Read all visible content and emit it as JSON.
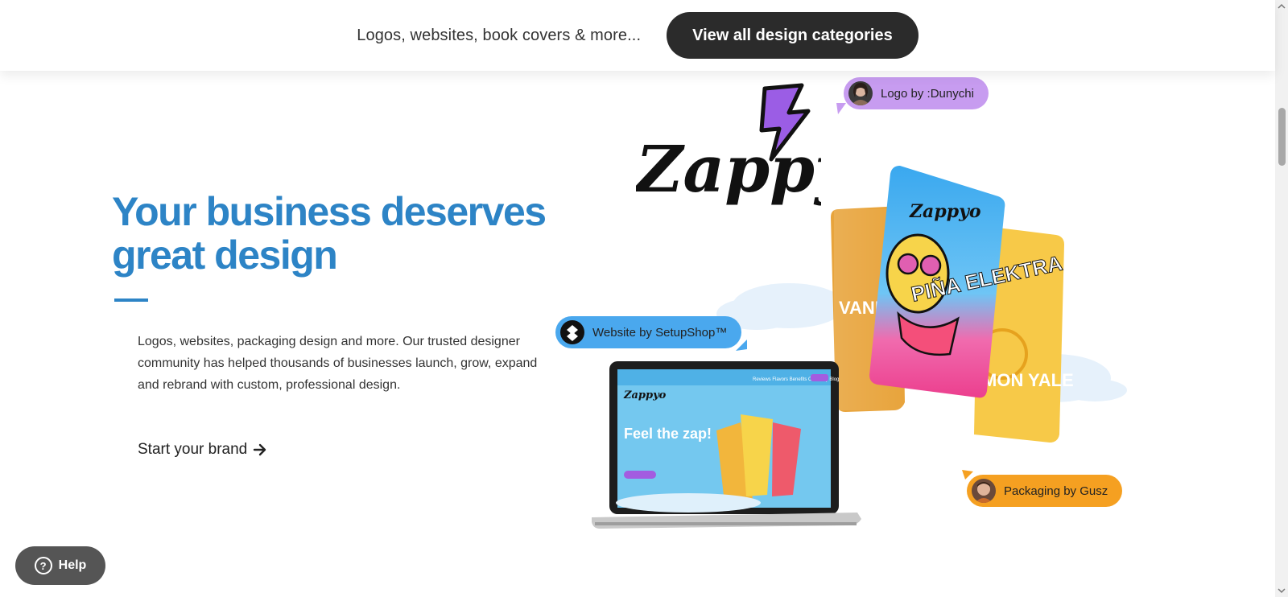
{
  "topbar": {
    "text": "Logos, websites, book covers & more...",
    "button_label": "View all design categories"
  },
  "hero": {
    "headline_line1": "Your business deserves",
    "headline_line2": "great design",
    "description": "Logos, websites, packaging design and more. Our trusted designer community has helped thousands of businesses launch, grow, expand and rebrand with custom, professional design.",
    "cta_label": "Start your brand"
  },
  "showcase": {
    "brand_logo_text": "Zappyo",
    "tags": {
      "logo": "Logo by :Dunychi",
      "website": "Website by SetupShop™",
      "packaging": "Packaging by Gusz"
    },
    "pouches": {
      "front_title": "PIÑA ELEKTRA",
      "left_title": "VANI SUN",
      "right_title": "MON YALE"
    },
    "laptop": {
      "headline": "Feel the zap!",
      "nav": [
        "Reviews",
        "Flavors",
        "Benefits",
        "Our story",
        "Blog",
        "Buy Now"
      ]
    },
    "colors": {
      "logo_tag": "#c79cf0",
      "website_tag": "#4aa8ee",
      "packaging_tag": "#f5a021",
      "accent": "#2d84c6"
    }
  },
  "help": {
    "label": "Help",
    "icon": "question-icon"
  }
}
